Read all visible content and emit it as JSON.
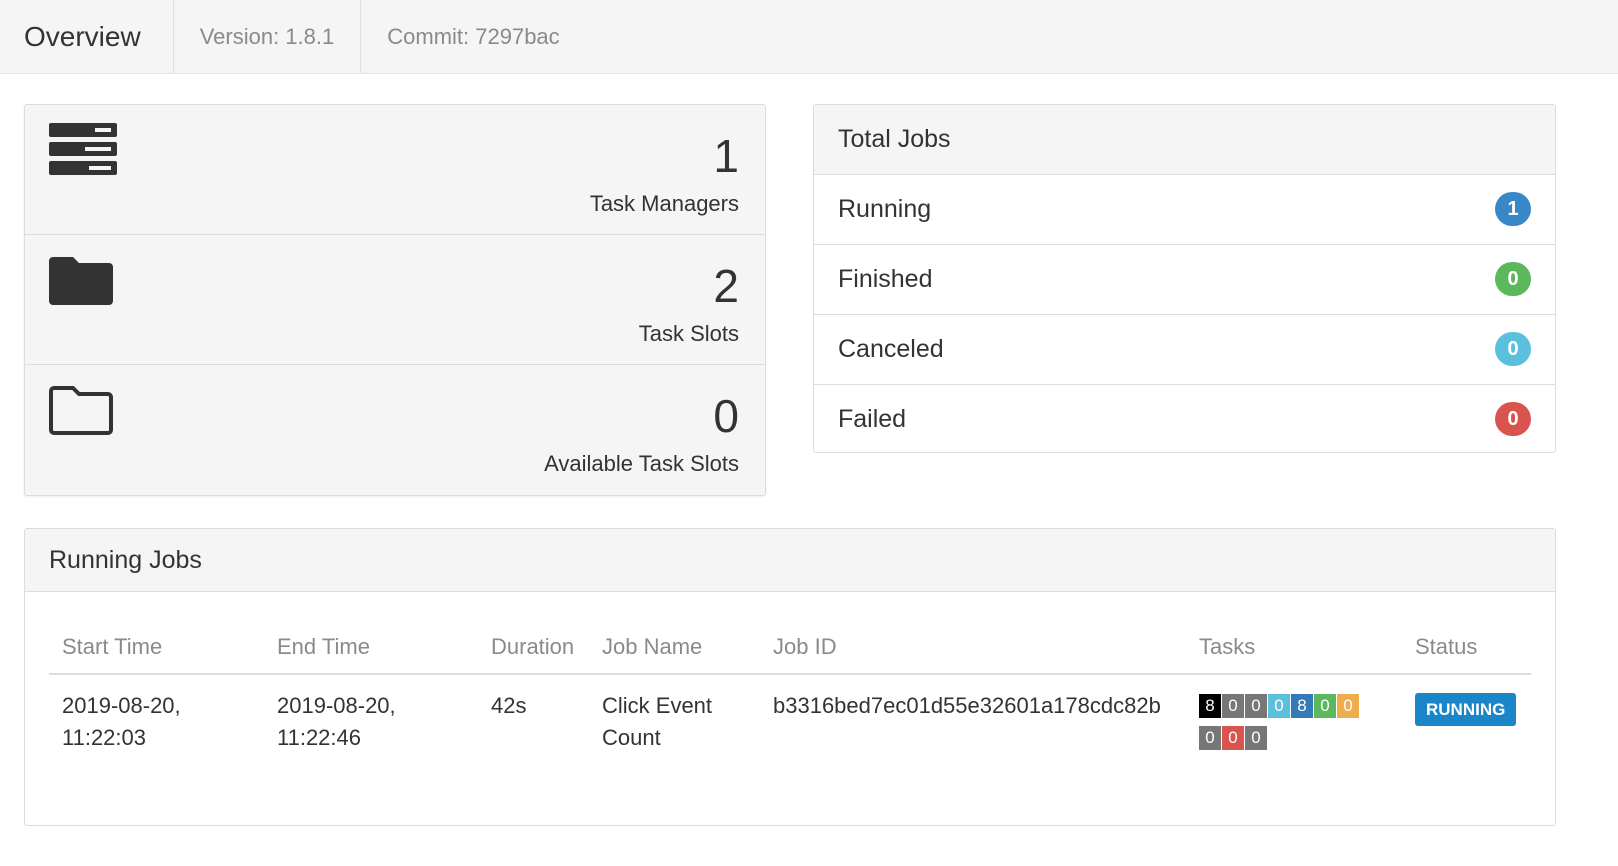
{
  "header": {
    "title": "Overview",
    "version": "Version: 1.8.1",
    "commit": "Commit: 7297bac"
  },
  "stats": [
    {
      "value": "1",
      "label": "Task Managers",
      "icon": "server-icon"
    },
    {
      "value": "2",
      "label": "Task Slots",
      "icon": "folder-solid-icon"
    },
    {
      "value": "0",
      "label": "Available Task Slots",
      "icon": "folder-outline-icon"
    }
  ],
  "total_jobs": {
    "title": "Total Jobs",
    "rows": [
      {
        "label": "Running",
        "count": "1",
        "color": "#3a87c8"
      },
      {
        "label": "Finished",
        "count": "0",
        "color": "#5cb85c"
      },
      {
        "label": "Canceled",
        "count": "0",
        "color": "#5bc0de"
      },
      {
        "label": "Failed",
        "count": "0",
        "color": "#d9534f"
      }
    ]
  },
  "running_jobs": {
    "title": "Running Jobs",
    "columns": [
      "Start Time",
      "End Time",
      "Duration",
      "Job Name",
      "Job ID",
      "Tasks",
      "Status"
    ],
    "rows": [
      {
        "start_line1": "2019-08-20,",
        "start_line2": "11:22:03",
        "end_line1": "2019-08-20,",
        "end_line2": "11:22:46",
        "duration": "42s",
        "name_line1": "Click Event",
        "name_line2": "Count",
        "job_id": "b3316bed7ec01d55e32601a178cdc82b",
        "tasks": [
          {
            "count": "8",
            "color": "#000000"
          },
          {
            "count": "0",
            "color": "#777777"
          },
          {
            "count": "0",
            "color": "#777777"
          },
          {
            "count": "0",
            "color": "#5bc0de"
          },
          {
            "count": "8",
            "color": "#337ab7"
          },
          {
            "count": "0",
            "color": "#5cb85c"
          },
          {
            "count": "0",
            "color": "#f0ad4e"
          },
          {
            "count": "0",
            "color": "#777777"
          },
          {
            "count": "0",
            "color": "#d9534f"
          },
          {
            "count": "0",
            "color": "#777777"
          }
        ],
        "status": "RUNNING",
        "status_color": "#1a86c8"
      }
    ]
  }
}
